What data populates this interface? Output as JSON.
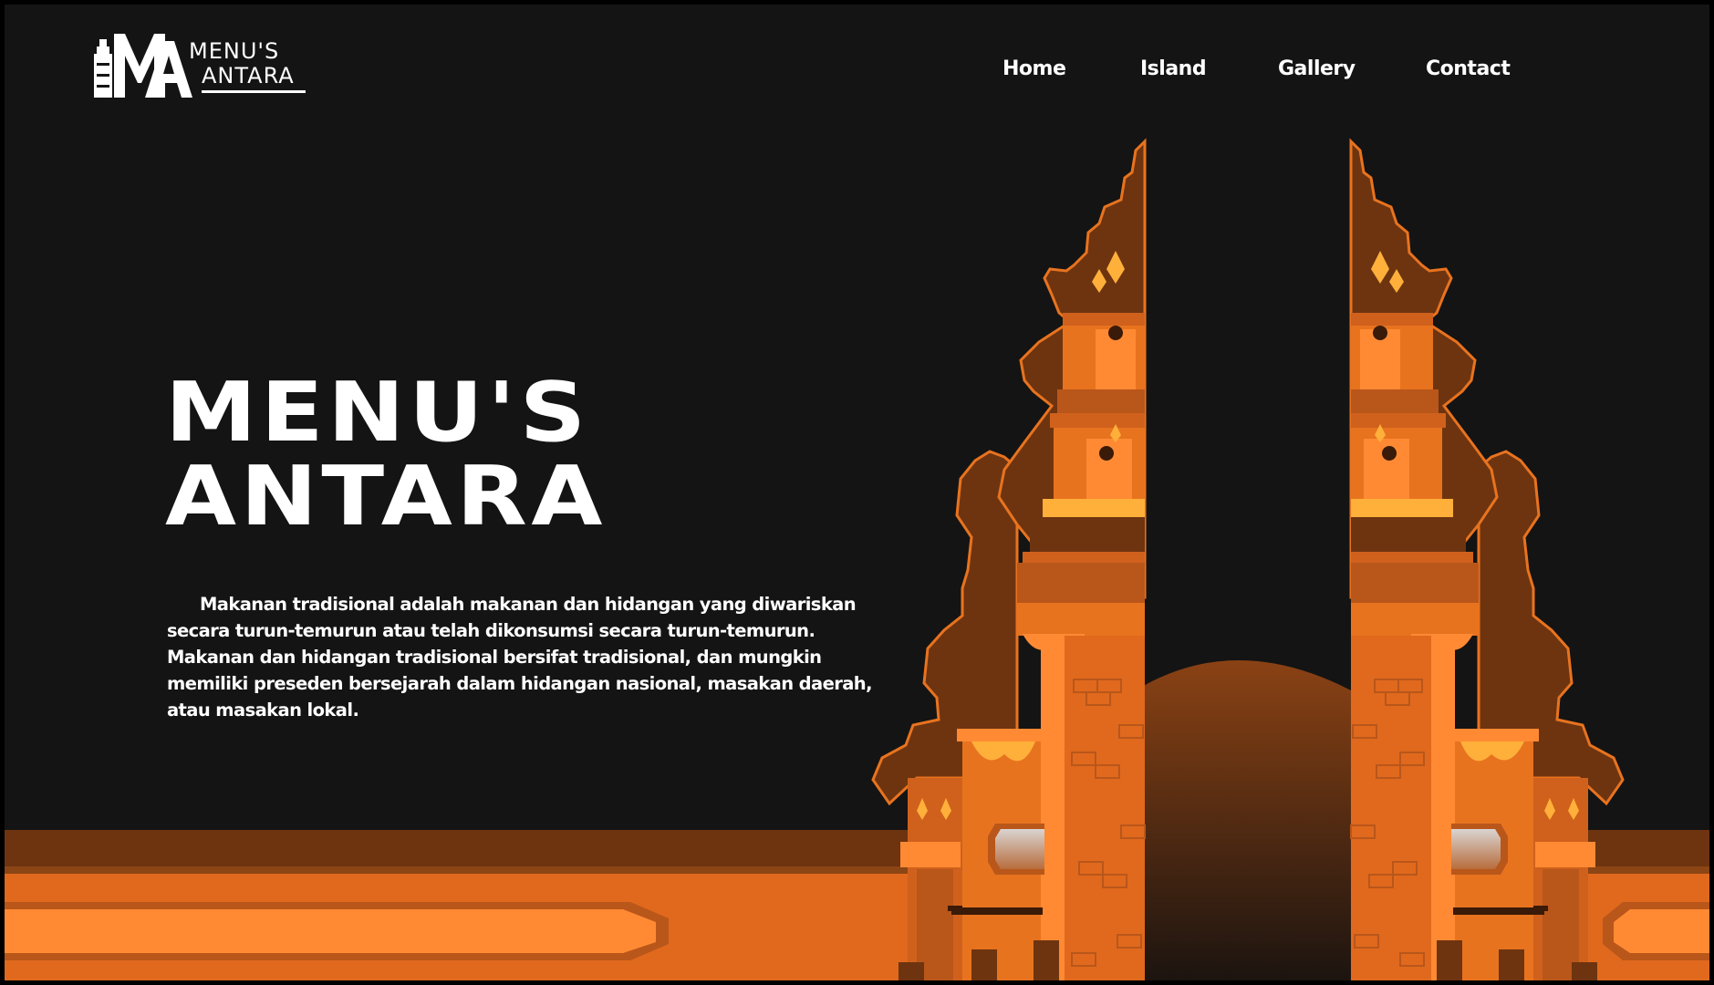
{
  "logo": {
    "word1": "MENU'S",
    "word2": "ANTARA"
  },
  "nav": {
    "items": [
      {
        "label": "Home"
      },
      {
        "label": "Island"
      },
      {
        "label": "Gallery"
      },
      {
        "label": "Contact"
      }
    ]
  },
  "hero": {
    "title_line1": "MENU'S",
    "title_line2": "ANTARA",
    "description": "Makanan tradisional adalah makanan dan hidangan yang diwariskan secara turun-temurun atau telah dikonsumsi secara turun-temurun. Makanan dan hidangan tradisional bersifat tradisional, dan mungkin memiliki preseden bersejarah dalam hidangan nasional, masakan daerah, atau masakan lokal."
  },
  "colors": {
    "background": "#141414",
    "gate_dark": "#6e3410",
    "gate_mid": "#c8561a",
    "gate_light": "#e8731f",
    "gate_bright": "#ff8c33",
    "text": "#ffffff"
  },
  "illustration": {
    "name": "bali-split-gate-icon"
  }
}
